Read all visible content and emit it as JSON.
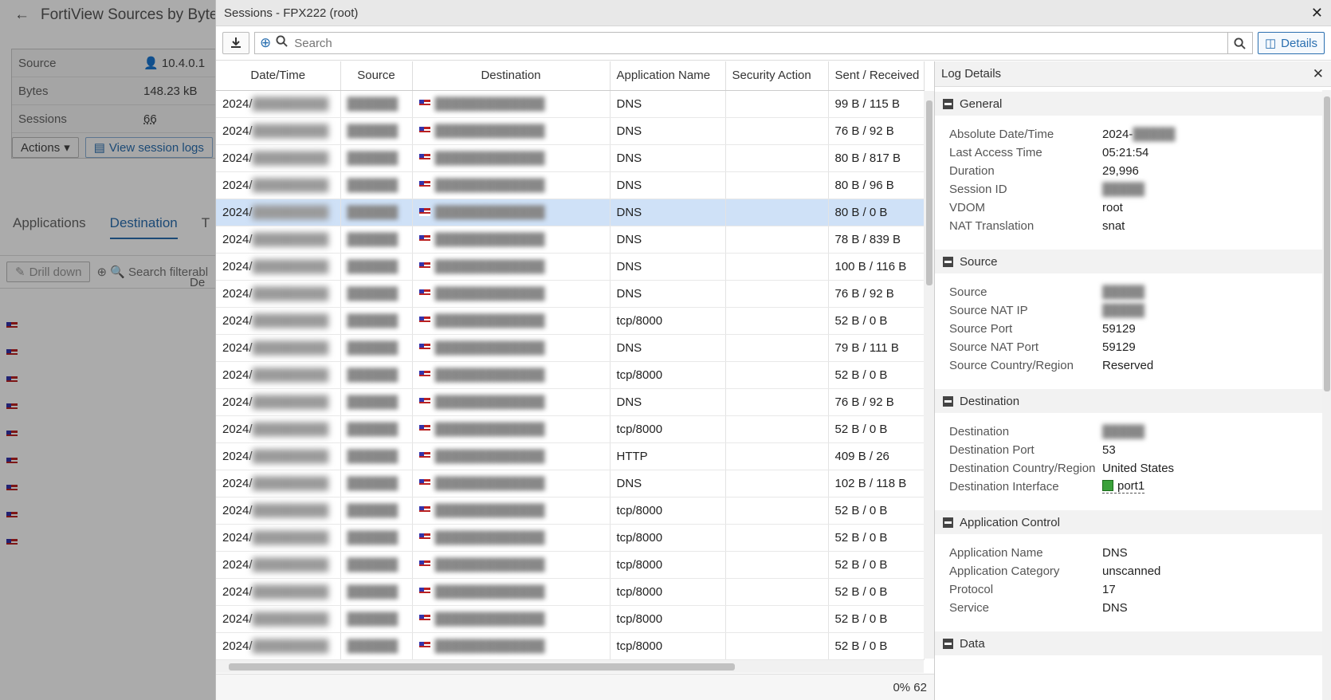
{
  "background": {
    "title": "FortiView Sources by Bytes",
    "summary": [
      {
        "label": "Source",
        "value": "10.4.0.1"
      },
      {
        "label": "Bytes",
        "value": "148.23 kB"
      },
      {
        "label": "Sessions",
        "value": "66"
      }
    ],
    "actions_label": "Actions",
    "view_logs_label": "View session logs",
    "tabs": [
      "Applications",
      "Destination",
      "T"
    ],
    "drill_down_label": "Drill down",
    "search_label": "Search filterabl",
    "col_head": "De"
  },
  "modal": {
    "title": "Sessions - FPX222 (root)",
    "search_placeholder": "Search",
    "details_label": "Details",
    "footer_text": "0% 62"
  },
  "table": {
    "columns": [
      "Date/Time",
      "Source",
      "Destination",
      "Application Name",
      "Security Action",
      "Sent / Received"
    ],
    "rows": [
      {
        "date": "2024/",
        "app": "DNS",
        "sent": "99 B / 115 B"
      },
      {
        "date": "2024/",
        "app": "DNS",
        "sent": "76 B / 92 B"
      },
      {
        "date": "2024/",
        "app": "DNS",
        "sent": "80 B / 817 B"
      },
      {
        "date": "2024/",
        "app": "DNS",
        "sent": "80 B / 96 B"
      },
      {
        "date": "2024/",
        "app": "DNS",
        "sent": "80 B / 0 B"
      },
      {
        "date": "2024/",
        "app": "DNS",
        "sent": "78 B / 839 B"
      },
      {
        "date": "2024/",
        "app": "DNS",
        "sent": "100 B / 116 B"
      },
      {
        "date": "2024/",
        "app": "DNS",
        "sent": "76 B / 92 B"
      },
      {
        "date": "2024/",
        "app": "tcp/8000",
        "sent": "52 B / 0 B"
      },
      {
        "date": "2024/",
        "app": "DNS",
        "sent": "79 B / 111 B"
      },
      {
        "date": "2024/",
        "app": "tcp/8000",
        "sent": "52 B / 0 B"
      },
      {
        "date": "2024/",
        "app": "DNS",
        "sent": "76 B / 92 B"
      },
      {
        "date": "2024/",
        "app": "tcp/8000",
        "sent": "52 B / 0 B"
      },
      {
        "date": "2024/",
        "app": "HTTP",
        "sent": "409 B / 26"
      },
      {
        "date": "2024/",
        "app": "DNS",
        "sent": "102 B / 118 B"
      },
      {
        "date": "2024/",
        "app": "tcp/8000",
        "sent": "52 B / 0 B"
      },
      {
        "date": "2024/",
        "app": "tcp/8000",
        "sent": "52 B / 0 B"
      },
      {
        "date": "2024/",
        "app": "tcp/8000",
        "sent": "52 B / 0 B"
      },
      {
        "date": "2024/",
        "app": "tcp/8000",
        "sent": "52 B / 0 B"
      },
      {
        "date": "2024/",
        "app": "tcp/8000",
        "sent": "52 B / 0 B"
      },
      {
        "date": "2024/",
        "app": "tcp/8000",
        "sent": "52 B / 0 B"
      }
    ],
    "selected_row": 4
  },
  "details": {
    "title": "Log Details",
    "sections": [
      {
        "name": "General",
        "items": [
          {
            "k": "Absolute Date/Time",
            "v": "2024-"
          },
          {
            "k": "Last Access Time",
            "v": "05:21:54"
          },
          {
            "k": "Duration",
            "v": "29,996"
          },
          {
            "k": "Session ID",
            "v": ""
          },
          {
            "k": "VDOM",
            "v": "root"
          },
          {
            "k": "NAT Translation",
            "v": "snat"
          }
        ]
      },
      {
        "name": "Source",
        "items": [
          {
            "k": "Source",
            "v": ""
          },
          {
            "k": "Source NAT IP",
            "v": ""
          },
          {
            "k": "Source Port",
            "v": "59129"
          },
          {
            "k": "Source NAT Port",
            "v": "59129"
          },
          {
            "k": "Source Country/Region",
            "v": "Reserved"
          }
        ]
      },
      {
        "name": "Destination",
        "items": [
          {
            "k": "Destination",
            "v": ""
          },
          {
            "k": "Destination Port",
            "v": "53"
          },
          {
            "k": "Destination Country/Region",
            "v": "United States"
          },
          {
            "k": "Destination Interface",
            "v": "port1",
            "port": true
          }
        ]
      },
      {
        "name": "Application Control",
        "items": [
          {
            "k": "Application Name",
            "v": "DNS"
          },
          {
            "k": "Application Category",
            "v": "unscanned"
          },
          {
            "k": "Protocol",
            "v": "17"
          },
          {
            "k": "Service",
            "v": "DNS"
          }
        ]
      },
      {
        "name": "Data",
        "items": []
      }
    ]
  },
  "colors": {
    "accent": "#2a6fb0",
    "selected": "#cfe1f7"
  }
}
